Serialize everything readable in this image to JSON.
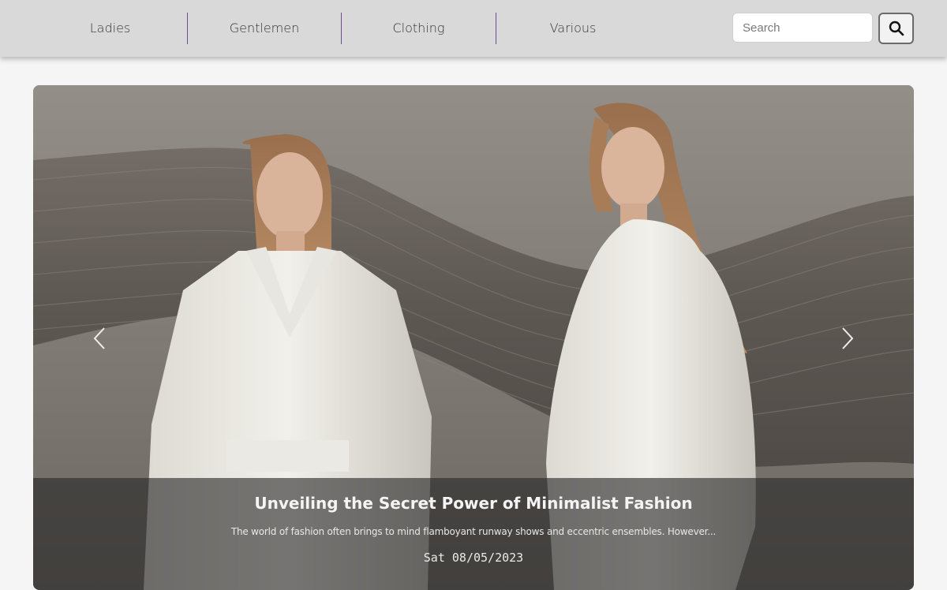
{
  "nav": {
    "items": [
      {
        "label": "Ladies"
      },
      {
        "label": "Gentlemen"
      },
      {
        "label": "Clothing"
      },
      {
        "label": "Various"
      }
    ]
  },
  "search": {
    "placeholder": "Search",
    "value": "",
    "button_icon": "search-icon"
  },
  "carousel": {
    "prev_icon": "chevron-left-icon",
    "next_icon": "chevron-right-icon",
    "slide": {
      "image": "two-models-in-white-minimalist-coats-photo",
      "title": "Unveiling the Secret Power of Minimalist Fashion",
      "excerpt": "The world of fashion often brings to mind flamboyant runway shows and eccentric ensembles. However...",
      "date": "Sat 08/05/2023"
    }
  },
  "colors": {
    "navbar_bg": "#d9d9d9",
    "nav_divider": "#6b4e8f",
    "page_bg": "#f5f5f5"
  }
}
